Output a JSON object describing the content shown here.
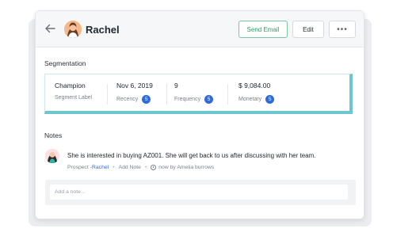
{
  "header": {
    "contact_name": "Rachel",
    "send_email_label": "Send Email",
    "edit_label": "Edit",
    "more_label": "•••"
  },
  "segmentation": {
    "title": "Segmentation",
    "items": [
      {
        "value": "Champion",
        "label": "Segment Label",
        "score": null
      },
      {
        "value": "Nov 6, 2019",
        "label": "Recency",
        "score": "5"
      },
      {
        "value": "9",
        "label": "Frequency",
        "score": "5"
      },
      {
        "value": "$ 9,084.00",
        "label": "Monetary",
        "score": "5"
      }
    ],
    "accent_color": "#6dc6d0"
  },
  "notes": {
    "title": "Notes",
    "entries": [
      {
        "text": "She is interested in buying AZ001. She will get back to us after discussing with her team.",
        "prospect_prefix": "Prospect - ",
        "prospect_name": "Rachel",
        "add_note_label": "Add Note",
        "time_info": "now by Amelia burrows"
      }
    ],
    "input_placeholder": "Add a note..."
  },
  "colors": {
    "email_border": "#79c7a0",
    "badge": "#2f6bd6",
    "link": "#2f6bd6"
  }
}
